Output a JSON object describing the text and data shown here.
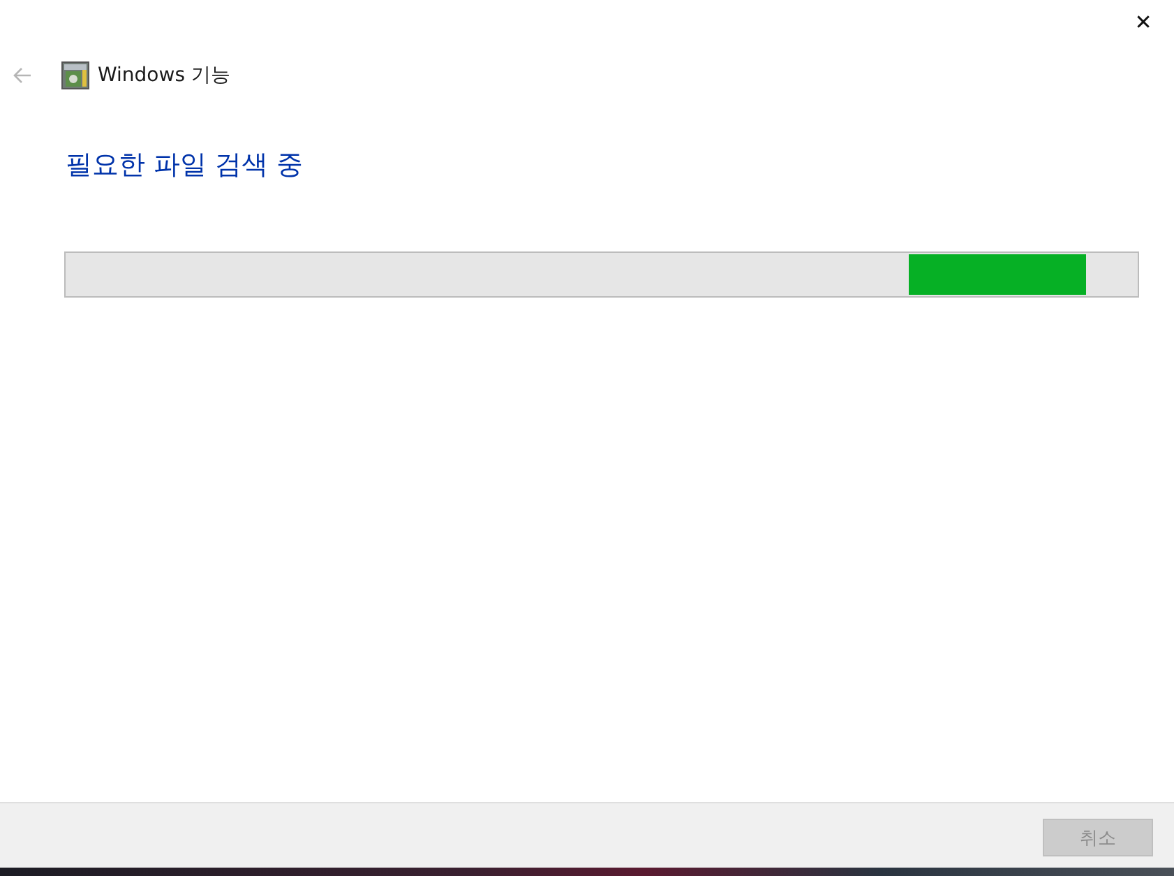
{
  "window": {
    "title": "Windows 기능",
    "close_label": "✕"
  },
  "back_button": {
    "disabled": true
  },
  "heading": "필요한 파일 검색 중",
  "progress": {
    "kind": "marquee"
  },
  "footer": {
    "cancel_button": {
      "label": "취소",
      "disabled": true
    }
  }
}
